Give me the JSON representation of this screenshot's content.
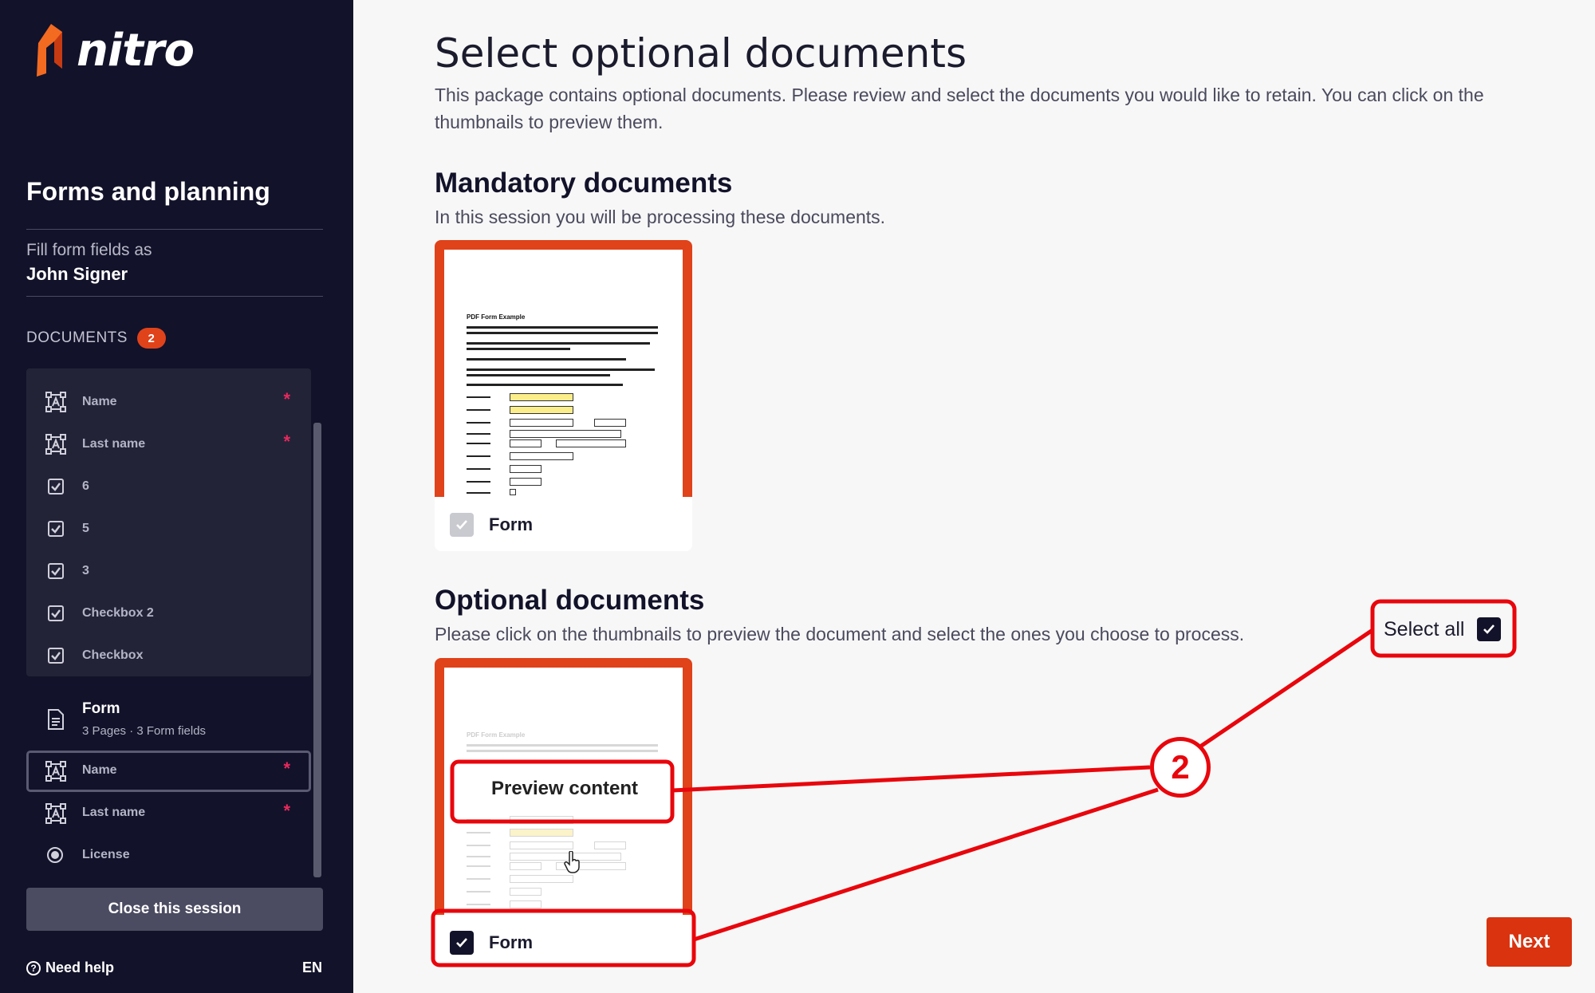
{
  "sidebar": {
    "brand": "nitro",
    "session_title": "Forms and planning",
    "fill_as_label": "Fill form fields as",
    "signer_name": "John Signer",
    "documents_label": "DOCUMENTS",
    "documents_count": "2",
    "fields_panel": [
      {
        "label": "Name",
        "icon": "text-field-icon",
        "required": "*"
      },
      {
        "label": "Last name",
        "icon": "text-field-icon",
        "required": "*"
      },
      {
        "label": "6",
        "icon": "checkbox-icon",
        "required": ""
      },
      {
        "label": "5",
        "icon": "checkbox-icon",
        "required": ""
      },
      {
        "label": "3",
        "icon": "checkbox-icon",
        "required": ""
      },
      {
        "label": "Checkbox 2",
        "icon": "checkbox-icon",
        "required": ""
      },
      {
        "label": "Checkbox",
        "icon": "checkbox-icon",
        "required": ""
      }
    ],
    "document": {
      "name": "Form",
      "meta": "3 Pages · 3 Form fields"
    },
    "doc_fields": [
      {
        "label": "Name",
        "icon": "text-field-icon",
        "required": "*"
      },
      {
        "label": "Last name",
        "icon": "text-field-icon",
        "required": "*"
      },
      {
        "label": "License",
        "icon": "radio-icon",
        "required": ""
      }
    ],
    "close_button": "Close this session",
    "help_label": "Need help",
    "language": "EN"
  },
  "main": {
    "title": "Select optional documents",
    "intro": "This package contains optional documents. Please review and select the documents you would like to retain. You can click on the thumbnails to preview them.",
    "mandatory": {
      "heading": "Mandatory documents",
      "subtitle": "In this session you will be processing these documents.",
      "card_name": "Form",
      "thumb_title": "PDF Form Example"
    },
    "optional": {
      "heading": "Optional documents",
      "subtitle": "Please click on the thumbnails to preview the document and select the ones you choose to process.",
      "card_name": "Form",
      "preview_label": "Preview content",
      "thumb_title": "PDF Form Example"
    },
    "select_all_label": "Select all",
    "next_button": "Next",
    "annotation_number": "2"
  },
  "colors": {
    "sidebar_bg": "#12122a",
    "accent": "#e0421a",
    "next_button": "#d9330f",
    "required_star": "#e8295c",
    "annotation": "#e8060c"
  }
}
